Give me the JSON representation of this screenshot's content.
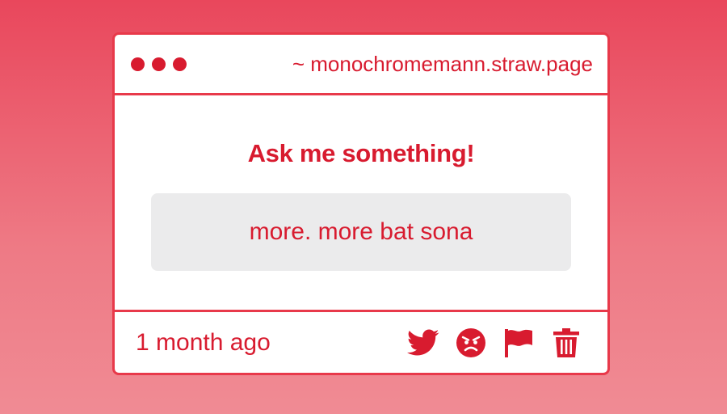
{
  "window": {
    "url": "~ monochromemann.straw.page"
  },
  "main": {
    "heading": "Ask me something!",
    "question": "more. more bat sona"
  },
  "footer": {
    "timestamp": "1 month ago",
    "actions": [
      {
        "icon": "twitter-icon"
      },
      {
        "icon": "angry-face-icon"
      },
      {
        "icon": "flag-icon"
      },
      {
        "icon": "trash-icon"
      }
    ]
  },
  "colors": {
    "accent": "#d81b2f",
    "border": "#e8394a",
    "background_top": "#e9475c",
    "background_bottom": "#f08b94",
    "question_bg": "#ebebec"
  }
}
